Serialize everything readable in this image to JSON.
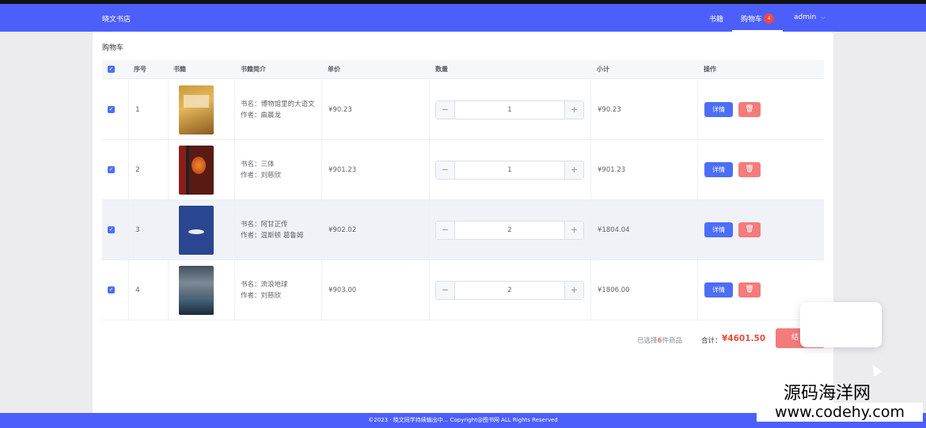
{
  "header": {
    "brand": "晓文书店",
    "nav_books": "书籍",
    "nav_cart": "购物车",
    "cart_badge": "4",
    "user": "admin"
  },
  "page_title": "购物车",
  "table": {
    "headers": [
      "",
      "序号",
      "书籍",
      "书籍简介",
      "单价",
      "数量",
      "小计",
      "操作"
    ],
    "rows": [
      {
        "index": "1",
        "intro_name": "书名：博物馆里的大语文",
        "intro_author": "作者：曲晨龙",
        "price": "¥90.23",
        "qty": "1",
        "subtotal": "¥90.23"
      },
      {
        "index": "2",
        "intro_name": "书名：三体",
        "intro_author": "作者：刘慈欣",
        "price": "¥901.23",
        "qty": "1",
        "subtotal": "¥901.23"
      },
      {
        "index": "3",
        "intro_name": "书名：阿甘正传",
        "intro_author": "作者：温斯顿 葛鲁姆",
        "price": "¥902.02",
        "qty": "2",
        "subtotal": "¥1804.04"
      },
      {
        "index": "4",
        "intro_name": "书名：流浪地球",
        "intro_author": "作者：刘慈欣",
        "price": "¥903.00",
        "qty": "2",
        "subtotal": "¥1806.00"
      }
    ],
    "btn_detail": "详情",
    "btn_delete_icon": "trash-icon",
    "btn_minus": "−",
    "btn_plus": "+"
  },
  "summary": {
    "selected_prefix": "已选择",
    "selected_count": "6",
    "selected_suffix": "件商品",
    "total_label": "合计：",
    "total_value": "¥4601.50",
    "checkout": "结"
  },
  "footer": "©2023 · 晓文同学持续输出中... Copyright@图书网 ALL Rights Reserved",
  "watermark": {
    "title": "源码海洋网",
    "url": "www.codehy.com"
  },
  "colors": {
    "primary": "#4c5ffb",
    "danger": "#f47b7b",
    "total": "#e74c3c"
  }
}
